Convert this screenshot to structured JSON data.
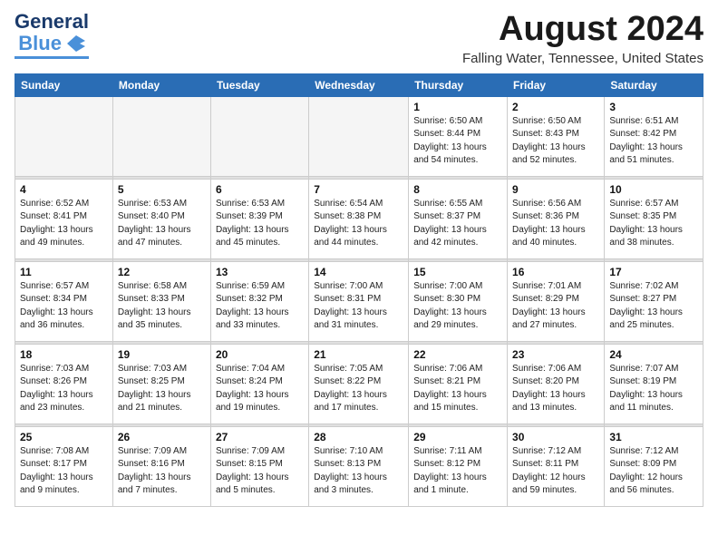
{
  "logo": {
    "text_general": "General",
    "text_blue": "Blue",
    "bird_symbol": "▶"
  },
  "header": {
    "month_year": "August 2024",
    "location": "Falling Water, Tennessee, United States"
  },
  "days_of_week": [
    "Sunday",
    "Monday",
    "Tuesday",
    "Wednesday",
    "Thursday",
    "Friday",
    "Saturday"
  ],
  "weeks": [
    {
      "days": [
        {
          "num": "",
          "info": ""
        },
        {
          "num": "",
          "info": ""
        },
        {
          "num": "",
          "info": ""
        },
        {
          "num": "",
          "info": ""
        },
        {
          "num": "1",
          "info": "Sunrise: 6:50 AM\nSunset: 8:44 PM\nDaylight: 13 hours\nand 54 minutes."
        },
        {
          "num": "2",
          "info": "Sunrise: 6:50 AM\nSunset: 8:43 PM\nDaylight: 13 hours\nand 52 minutes."
        },
        {
          "num": "3",
          "info": "Sunrise: 6:51 AM\nSunset: 8:42 PM\nDaylight: 13 hours\nand 51 minutes."
        }
      ]
    },
    {
      "days": [
        {
          "num": "4",
          "info": "Sunrise: 6:52 AM\nSunset: 8:41 PM\nDaylight: 13 hours\nand 49 minutes."
        },
        {
          "num": "5",
          "info": "Sunrise: 6:53 AM\nSunset: 8:40 PM\nDaylight: 13 hours\nand 47 minutes."
        },
        {
          "num": "6",
          "info": "Sunrise: 6:53 AM\nSunset: 8:39 PM\nDaylight: 13 hours\nand 45 minutes."
        },
        {
          "num": "7",
          "info": "Sunrise: 6:54 AM\nSunset: 8:38 PM\nDaylight: 13 hours\nand 44 minutes."
        },
        {
          "num": "8",
          "info": "Sunrise: 6:55 AM\nSunset: 8:37 PM\nDaylight: 13 hours\nand 42 minutes."
        },
        {
          "num": "9",
          "info": "Sunrise: 6:56 AM\nSunset: 8:36 PM\nDaylight: 13 hours\nand 40 minutes."
        },
        {
          "num": "10",
          "info": "Sunrise: 6:57 AM\nSunset: 8:35 PM\nDaylight: 13 hours\nand 38 minutes."
        }
      ]
    },
    {
      "days": [
        {
          "num": "11",
          "info": "Sunrise: 6:57 AM\nSunset: 8:34 PM\nDaylight: 13 hours\nand 36 minutes."
        },
        {
          "num": "12",
          "info": "Sunrise: 6:58 AM\nSunset: 8:33 PM\nDaylight: 13 hours\nand 35 minutes."
        },
        {
          "num": "13",
          "info": "Sunrise: 6:59 AM\nSunset: 8:32 PM\nDaylight: 13 hours\nand 33 minutes."
        },
        {
          "num": "14",
          "info": "Sunrise: 7:00 AM\nSunset: 8:31 PM\nDaylight: 13 hours\nand 31 minutes."
        },
        {
          "num": "15",
          "info": "Sunrise: 7:00 AM\nSunset: 8:30 PM\nDaylight: 13 hours\nand 29 minutes."
        },
        {
          "num": "16",
          "info": "Sunrise: 7:01 AM\nSunset: 8:29 PM\nDaylight: 13 hours\nand 27 minutes."
        },
        {
          "num": "17",
          "info": "Sunrise: 7:02 AM\nSunset: 8:27 PM\nDaylight: 13 hours\nand 25 minutes."
        }
      ]
    },
    {
      "days": [
        {
          "num": "18",
          "info": "Sunrise: 7:03 AM\nSunset: 8:26 PM\nDaylight: 13 hours\nand 23 minutes."
        },
        {
          "num": "19",
          "info": "Sunrise: 7:03 AM\nSunset: 8:25 PM\nDaylight: 13 hours\nand 21 minutes."
        },
        {
          "num": "20",
          "info": "Sunrise: 7:04 AM\nSunset: 8:24 PM\nDaylight: 13 hours\nand 19 minutes."
        },
        {
          "num": "21",
          "info": "Sunrise: 7:05 AM\nSunset: 8:22 PM\nDaylight: 13 hours\nand 17 minutes."
        },
        {
          "num": "22",
          "info": "Sunrise: 7:06 AM\nSunset: 8:21 PM\nDaylight: 13 hours\nand 15 minutes."
        },
        {
          "num": "23",
          "info": "Sunrise: 7:06 AM\nSunset: 8:20 PM\nDaylight: 13 hours\nand 13 minutes."
        },
        {
          "num": "24",
          "info": "Sunrise: 7:07 AM\nSunset: 8:19 PM\nDaylight: 13 hours\nand 11 minutes."
        }
      ]
    },
    {
      "days": [
        {
          "num": "25",
          "info": "Sunrise: 7:08 AM\nSunset: 8:17 PM\nDaylight: 13 hours\nand 9 minutes."
        },
        {
          "num": "26",
          "info": "Sunrise: 7:09 AM\nSunset: 8:16 PM\nDaylight: 13 hours\nand 7 minutes."
        },
        {
          "num": "27",
          "info": "Sunrise: 7:09 AM\nSunset: 8:15 PM\nDaylight: 13 hours\nand 5 minutes."
        },
        {
          "num": "28",
          "info": "Sunrise: 7:10 AM\nSunset: 8:13 PM\nDaylight: 13 hours\nand 3 minutes."
        },
        {
          "num": "29",
          "info": "Sunrise: 7:11 AM\nSunset: 8:12 PM\nDaylight: 13 hours\nand 1 minute."
        },
        {
          "num": "30",
          "info": "Sunrise: 7:12 AM\nSunset: 8:11 PM\nDaylight: 12 hours\nand 59 minutes."
        },
        {
          "num": "31",
          "info": "Sunrise: 7:12 AM\nSunset: 8:09 PM\nDaylight: 12 hours\nand 56 minutes."
        }
      ]
    }
  ]
}
